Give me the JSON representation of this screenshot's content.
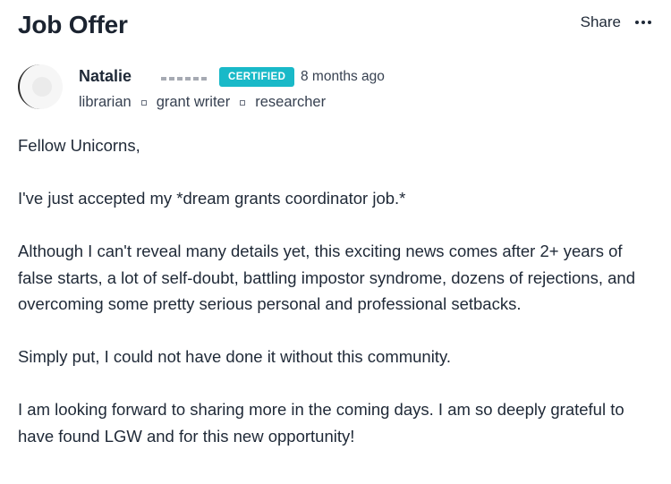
{
  "header": {
    "title": "Job Offer",
    "share_label": "Share",
    "more_icon": "more-horizontal-icon"
  },
  "author": {
    "name": "Natalie",
    "badge": "CERTIFIED",
    "badge_color": "#19b9c8",
    "timestamp": "8 months ago",
    "tags": [
      "librarian",
      "grant writer",
      "researcher"
    ]
  },
  "post": {
    "paragraphs": [
      "Fellow Unicorns,",
      "I've just accepted my *dream grants coordinator job.*",
      "Although I can't reveal many details yet, this exciting news comes after 2+ years of false starts, a lot of self-doubt, battling impostor syndrome, dozens of rejections, and overcoming some pretty serious personal and professional setbacks.",
      "Simply put, I could not have done it without this community.",
      "I am looking forward to sharing more in the coming days. I am so deeply grateful to have found LGW and for this new opportunity!"
    ]
  }
}
